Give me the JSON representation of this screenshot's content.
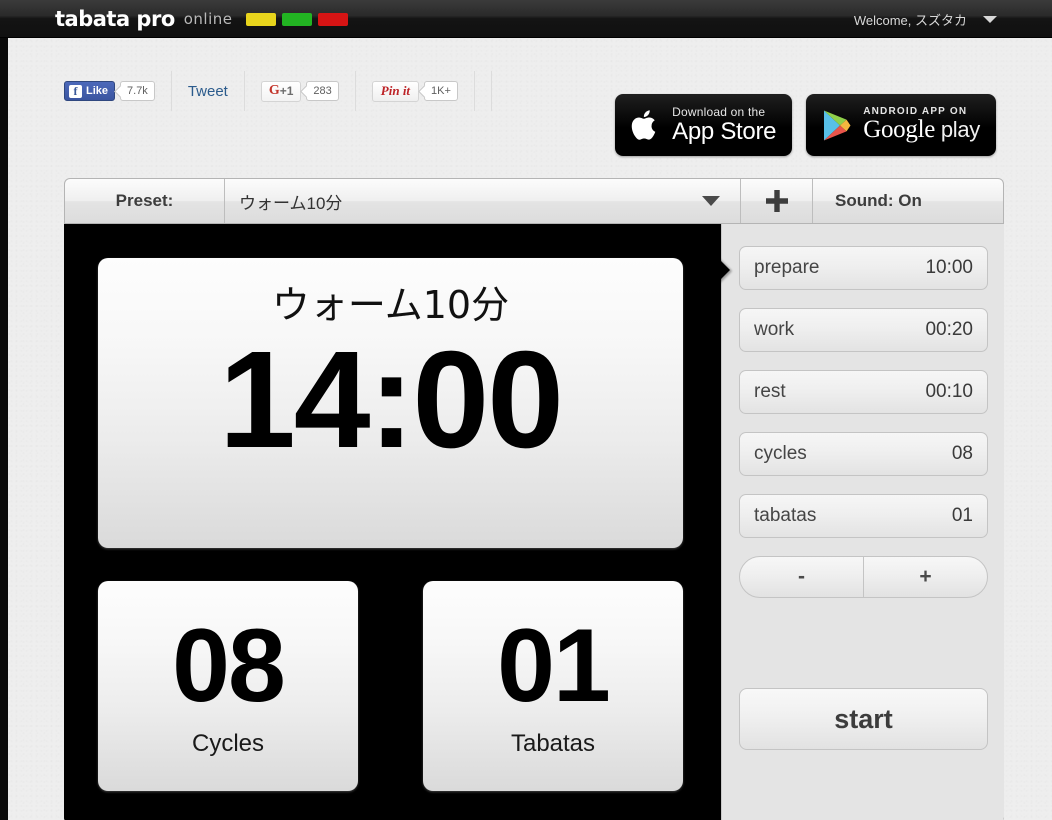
{
  "topnav": {
    "logo_bold": "tabata pro",
    "logo_thin": "online",
    "logo_bar_colors": [
      "#e8d41c",
      "#22b422",
      "#d61414"
    ],
    "welcome": "Welcome, スズタカ"
  },
  "social": {
    "facebook": {
      "icon": "f",
      "label": "Like",
      "count": "7.7k"
    },
    "twitter": {
      "label": "Tweet"
    },
    "googleplus": {
      "g": "G",
      "plus": "+1",
      "count": "283"
    },
    "pinterest": {
      "label": "Pin it",
      "count": "1K+"
    }
  },
  "badges": {
    "appstore": {
      "small": "Download on the",
      "big": "App Store"
    },
    "googleplay": {
      "small": "ANDROID APP ON",
      "big": "Google",
      "big2": " play"
    }
  },
  "toolbar": {
    "preset_label": "Preset:",
    "preset_value": "ウォーム10分",
    "add_label": "+",
    "sound_label": "Sound: On"
  },
  "display": {
    "title": "ウォーム10分",
    "time": "14:00"
  },
  "counters": [
    {
      "value": "08",
      "label": "Cycles"
    },
    {
      "value": "01",
      "label": "Tabatas"
    }
  ],
  "settings_rows": [
    {
      "name": "prepare",
      "value": "10:00"
    },
    {
      "name": "work",
      "value": "00:20"
    },
    {
      "name": "rest",
      "value": "00:10"
    },
    {
      "name": "cycles",
      "value": "08"
    },
    {
      "name": "tabatas",
      "value": "01"
    }
  ],
  "stepper": {
    "minus": "-",
    "plus": "+"
  },
  "start_button": "start"
}
